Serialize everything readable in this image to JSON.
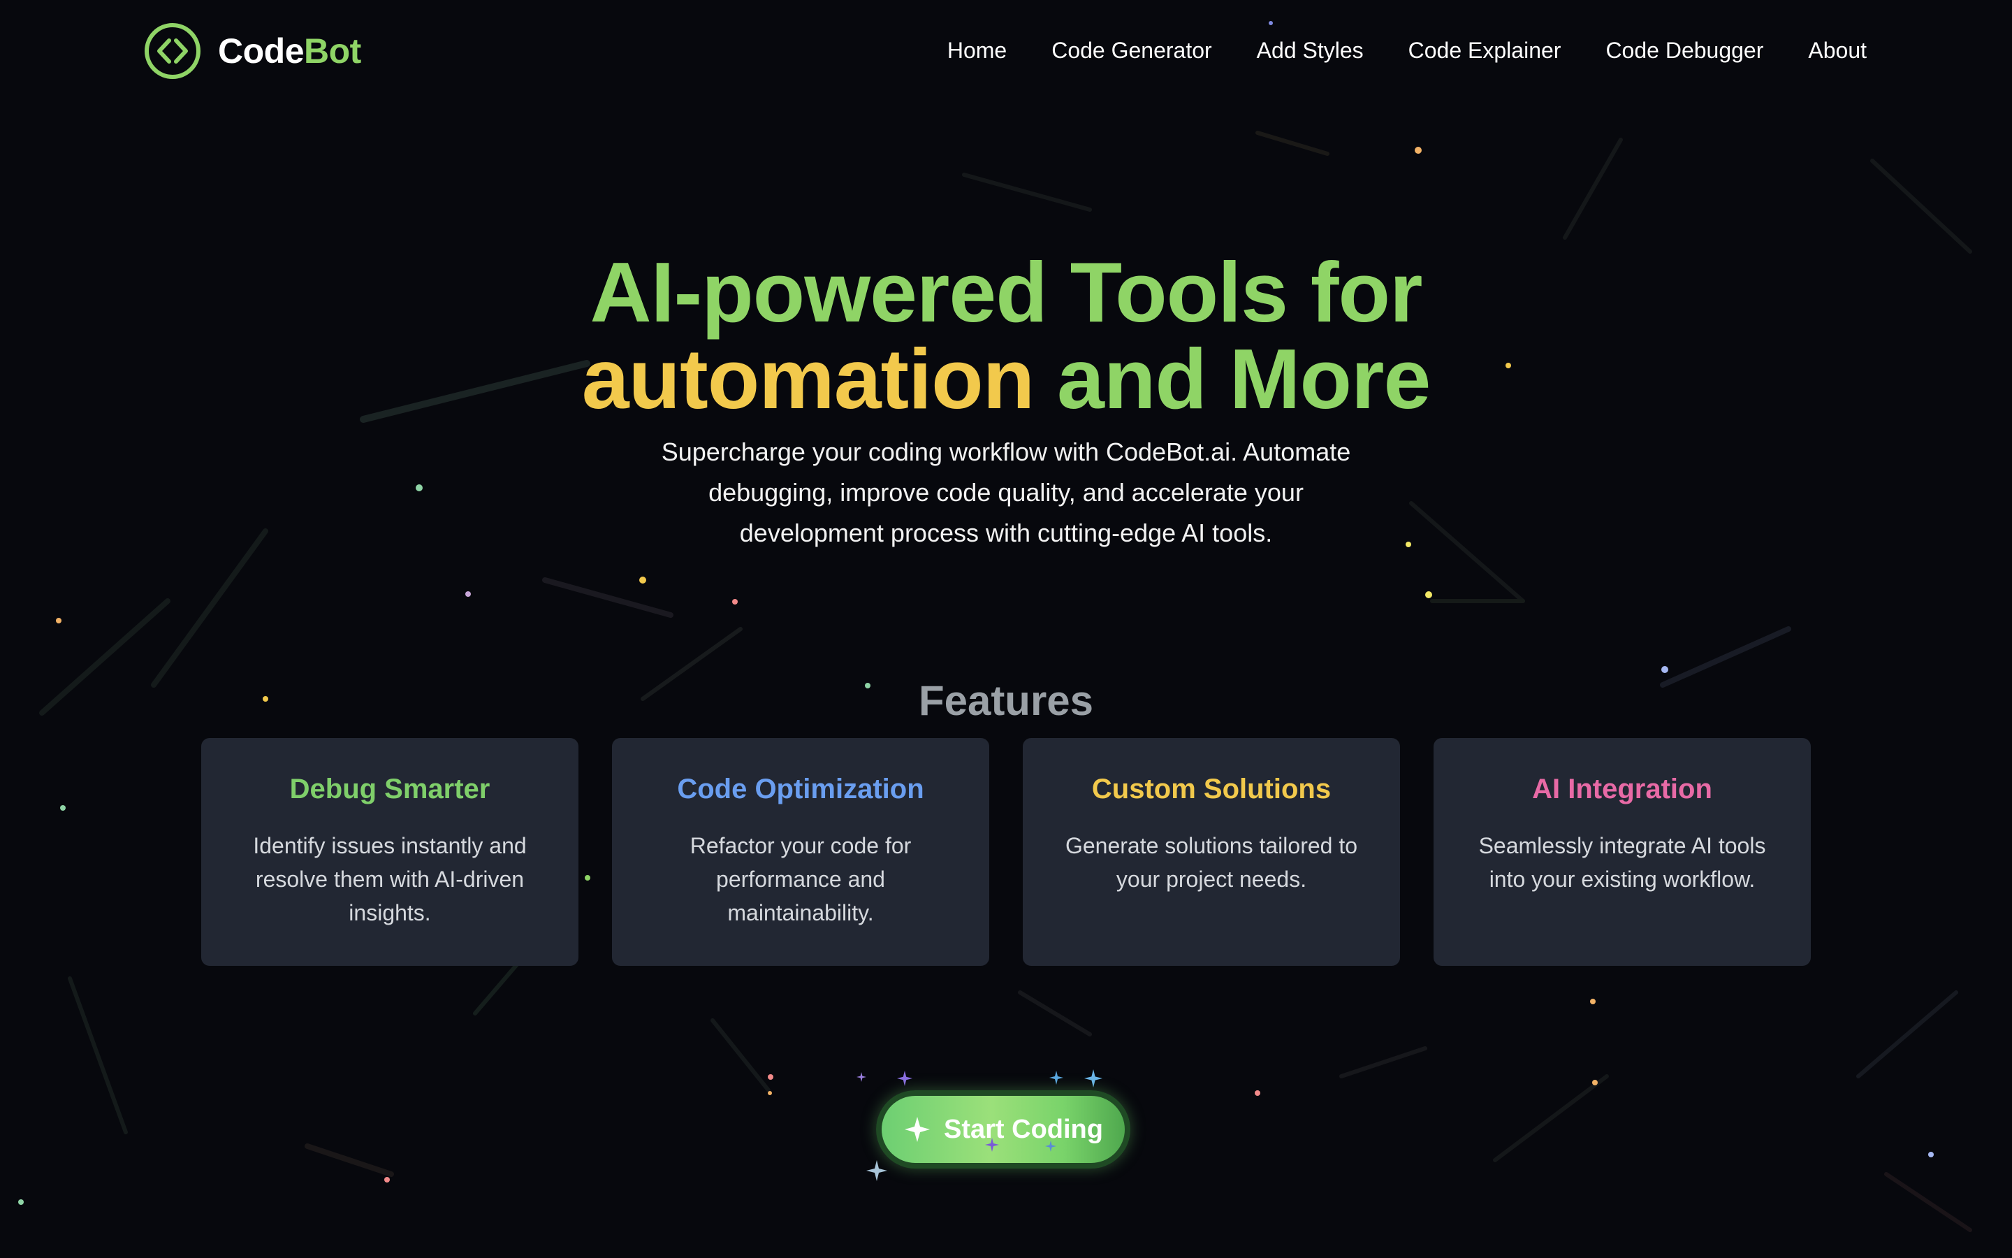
{
  "nav": {
    "brand_part1": "Code",
    "brand_part2": "Bot",
    "logo_icon": "code-brackets-circle-icon",
    "links": [
      {
        "label": "Home"
      },
      {
        "label": "Code Generator"
      },
      {
        "label": "Add Styles"
      },
      {
        "label": "Code Explainer"
      },
      {
        "label": "Code Debugger"
      },
      {
        "label": "About"
      }
    ]
  },
  "hero": {
    "title_line1": "AI-powered Tools for",
    "title_line2_highlight": "automation",
    "title_line2_rest": " and More",
    "subtitle": "Supercharge your coding workflow with CodeBot.ai. Automate debugging, improve code quality, and accelerate your development process with cutting-edge AI tools."
  },
  "features": {
    "heading": "Features",
    "cards": [
      {
        "title": "Debug Smarter",
        "description": "Identify issues instantly and resolve them with AI-driven insights.",
        "color": "#7fcf6a"
      },
      {
        "title": "Code Optimization",
        "description": "Refactor your code for performance and maintainability.",
        "color": "#6a9ef0"
      },
      {
        "title": "Custom Solutions",
        "description": "Generate solutions tailored to your project needs.",
        "color": "#f2c94c"
      },
      {
        "title": "AI Integration",
        "description": "Seamlessly integrate AI tools into your existing workflow.",
        "color": "#e86aa6"
      }
    ]
  },
  "cta": {
    "label": "Start Coding",
    "icon": "sparkle-icon"
  },
  "colors": {
    "background": "#07080d",
    "accent_green": "#8fd466",
    "accent_yellow": "#f2c94c",
    "card_bg": "#222733",
    "heading_gray": "#9aa0a6"
  }
}
